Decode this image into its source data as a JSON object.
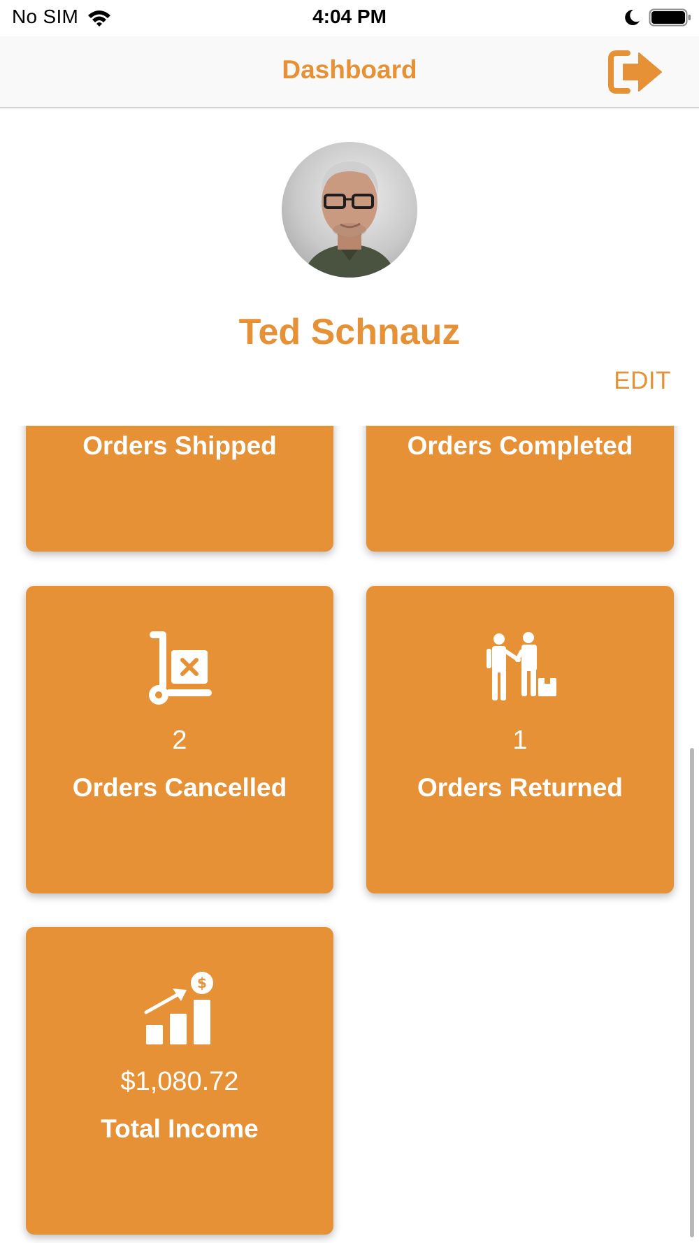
{
  "status_bar": {
    "carrier": "No SIM",
    "time": "4:04 PM",
    "icons": [
      "wifi-icon",
      "moon-icon",
      "battery-icon"
    ]
  },
  "nav": {
    "title": "Dashboard",
    "logout_icon": "logout-icon"
  },
  "profile": {
    "name": "Ted Schnauz",
    "edit_label": "EDIT"
  },
  "cards": {
    "shipped": {
      "label": "Orders Shipped"
    },
    "completed": {
      "label": "Orders Completed"
    },
    "cancelled": {
      "value": "2",
      "label": "Orders Cancelled",
      "icon": "cart-cancel-icon"
    },
    "returned": {
      "value": "1",
      "label": "Orders Returned",
      "icon": "return-icon"
    },
    "income": {
      "value": "$1,080.72",
      "label": "Total Income",
      "icon": "income-chart-icon"
    }
  },
  "colors": {
    "accent": "#e69135",
    "card_text": "#ffffff",
    "nav_background": "#f9f9f9"
  }
}
